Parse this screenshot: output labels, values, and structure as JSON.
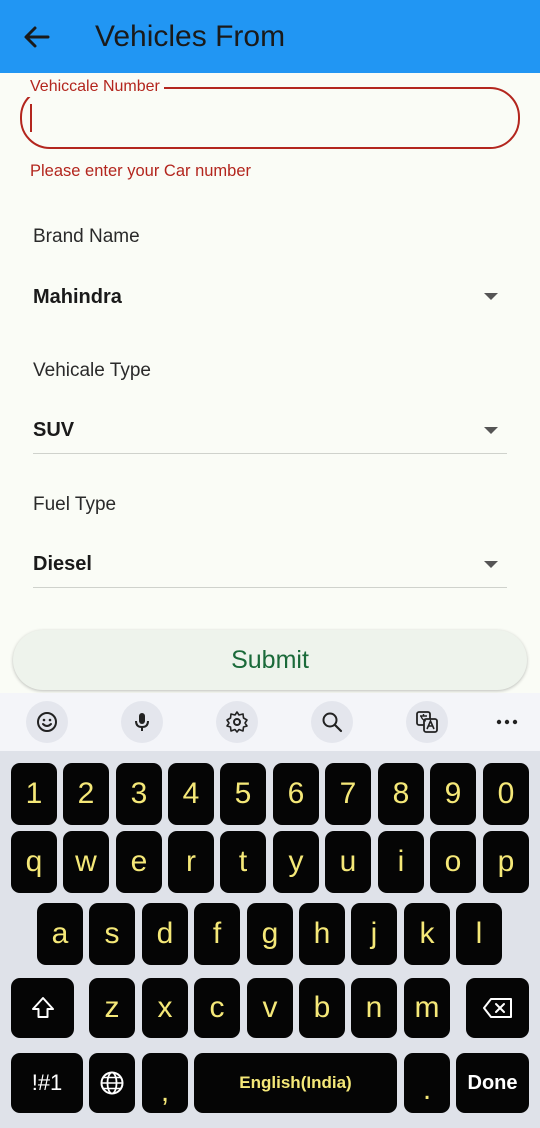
{
  "appbar": {
    "title": "Vehicles From",
    "back_icon": "arrow-left-icon",
    "bg_color": "#2196f3"
  },
  "form": {
    "vehicle_number": {
      "label": "Vehiccale Number",
      "value": "",
      "error": "Please enter your Car number",
      "error_color": "#b3261e"
    },
    "brand": {
      "label": "Brand Name",
      "value": "Mahindra"
    },
    "vehicle_type": {
      "label": "Vehicale Type",
      "value": "SUV"
    },
    "fuel_type": {
      "label": "Fuel Type",
      "value": "Diesel"
    },
    "submit_label": "Submit"
  },
  "keyboard": {
    "toolbar": [
      "emoji-icon",
      "microphone-icon",
      "settings-icon",
      "search-icon",
      "translate-icon",
      "more-icon"
    ],
    "row_numbers": [
      "1",
      "2",
      "3",
      "4",
      "5",
      "6",
      "7",
      "8",
      "9",
      "0"
    ],
    "row_1": [
      "q",
      "w",
      "e",
      "r",
      "t",
      "y",
      "u",
      "i",
      "o",
      "p"
    ],
    "row_2": [
      "a",
      "s",
      "d",
      "f",
      "g",
      "h",
      "j",
      "k",
      "l"
    ],
    "row_3": [
      "z",
      "x",
      "c",
      "v",
      "b",
      "n",
      "m"
    ],
    "symbols_label": "!#1",
    "comma_label": ",",
    "space_label": "English(India)",
    "period_label": ".",
    "done_label": "Done",
    "key_text_color": "#f5e878"
  }
}
